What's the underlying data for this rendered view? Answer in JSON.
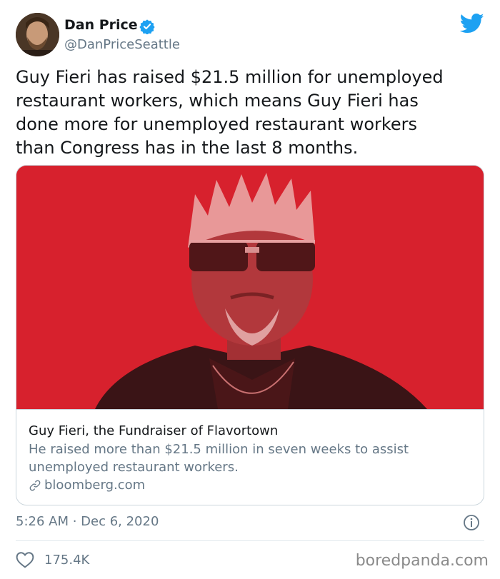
{
  "author": {
    "display_name": "Dan Price",
    "handle": "@DanPriceSeattle",
    "verified_icon": "verified-badge-icon",
    "avatar_icon": "avatar"
  },
  "platform_icon": "twitter-bird-icon",
  "tweet": {
    "text": "Guy Fieri has raised $21.5 million for unemployed\nrestaurant workers, which means Guy Fieri has\ndone more for unemployed restaurant workers\nthan Congress has in the last 8 months."
  },
  "card": {
    "image_background": "#d7212d",
    "title": "Guy Fieri, the Fundraiser of Flavortown",
    "description": "He raised more than $21.5 million in seven weeks to assist\nunemployed restaurant workers.",
    "link": "bloomberg.com",
    "link_icon": "link-icon"
  },
  "meta": {
    "timestamp": "5:26 AM · Dec 6, 2020",
    "info_icon": "info-icon"
  },
  "engagement": {
    "like_icon": "heart-icon",
    "likes": "175.4K"
  },
  "watermark": "boredpanda.com",
  "colors": {
    "twitter_blue": "#1da1f2",
    "secondary_text": "#657786",
    "card_red": "#d7212d"
  }
}
